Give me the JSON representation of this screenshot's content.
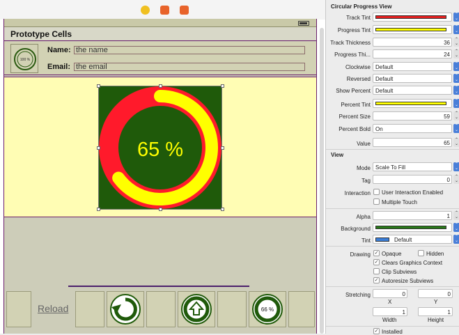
{
  "prototype_cells_title": "Prototype Cells",
  "cell1": {
    "thumb_percent": "100 %",
    "name_label": "Name:",
    "name_value": "the name",
    "email_label": "Email:",
    "email_value": "the email"
  },
  "progress_view": {
    "value_fraction": 0.65,
    "label": "65 %",
    "colors": {
      "background": "#1f5a0a",
      "track": "#ff1a2b",
      "progress": "#ffff00",
      "text": "#ffff00"
    }
  },
  "tabbar": {
    "reload_label": "Reload",
    "badge_percent": "66 %"
  },
  "inspector": {
    "circular_section_title": "Circular Progress View",
    "track_tint_label": "Track Tint",
    "track_tint_color": "#e51e1e",
    "progress_tint_label": "Progress Tint",
    "progress_tint_color": "#ffff00",
    "track_thickness_label": "Track Thickness",
    "track_thickness_value": "36",
    "progress_thickness_label": "Progress Thi...",
    "progress_thickness_value": "24",
    "clockwise_label": "Clockwise",
    "clockwise_value": "Default",
    "reversed_label": "Reversed",
    "reversed_value": "Default",
    "show_percent_label": "Show Percent",
    "show_percent_value": "Default",
    "percent_tint_label": "Percent Tint",
    "percent_tint_color": "#ffff00",
    "percent_size_label": "Percent Size",
    "percent_size_value": "59",
    "percent_bold_label": "Percent Bold",
    "percent_bold_value": "On",
    "value_label": "Value",
    "value_value": "65",
    "view_section_title": "View",
    "mode_label": "Mode",
    "mode_value": "Scale To Fill",
    "tag_label": "Tag",
    "tag_value": "0",
    "interaction_label": "Interaction",
    "user_interaction_label": "User Interaction Enabled",
    "multiple_touch_label": "Multiple Touch",
    "alpha_label": "Alpha",
    "alpha_value": "1",
    "background_label": "Background",
    "background_color": "#2a7a1a",
    "tint_label": "Tint",
    "tint_value": "Default",
    "tint_color": "#3b7fd9",
    "drawing_label": "Drawing",
    "opaque_label": "Opaque",
    "hidden_label": "Hidden",
    "clears_graphics_label": "Clears Graphics Context",
    "clip_subviews_label": "Clip Subviews",
    "autoresize_label": "Autoresize Subviews",
    "stretching_label": "Stretching",
    "stretch_x_value": "0",
    "stretch_y_value": "0",
    "x_label": "X",
    "y_label": "Y",
    "stretch_width_value": "1",
    "stretch_height_value": "1",
    "width_label": "Width",
    "height_label": "Height",
    "installed_label": "Installed"
  }
}
